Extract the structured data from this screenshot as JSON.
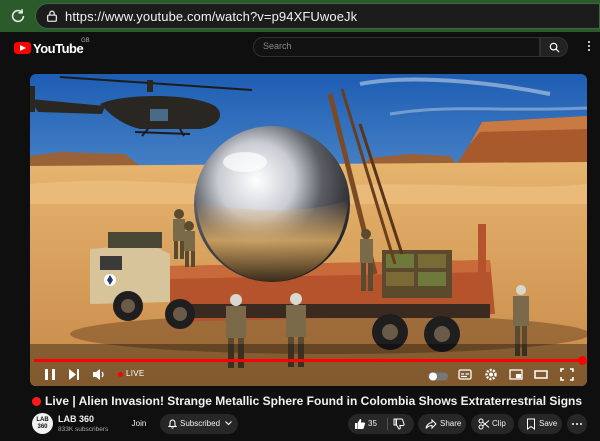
{
  "browser": {
    "url": "https://www.youtube.com/watch?v=p94XFUwoeJk"
  },
  "header": {
    "logo_text": "YouTube",
    "country_code": "GB",
    "search_placeholder": "Search"
  },
  "player": {
    "progress": 1.0,
    "live_label": "LIVE"
  },
  "video": {
    "live_prefix": "Live",
    "title": "Alien Invasion! Strange Metallic Sphere Found in Colombia Shows Extraterrestrial Signs"
  },
  "channel": {
    "avatar_line1": "LAB",
    "avatar_line2": "360",
    "name": "LAB 360",
    "subscribers": "833K subscribers",
    "join_label": "Join",
    "subscribed_label": "Subscribed"
  },
  "actions": {
    "like_count": "35",
    "share_label": "Share",
    "clip_label": "Clip",
    "save_label": "Save"
  },
  "colors": {
    "accent": "#ff0000",
    "browser_bar": "#2b5a2b",
    "background": "#0f0f0f"
  }
}
